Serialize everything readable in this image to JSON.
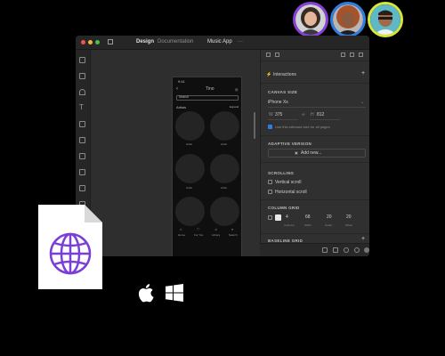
{
  "colors": {
    "background": "#000000",
    "accent_purple": "#7a3fd6",
    "avatar_ring_1": "#8b3fd9",
    "avatar_ring_2": "#2f7de0",
    "avatar_ring_3": "#d7e63a",
    "traffic_red": "#f0564b",
    "traffic_yellow": "#f1b83a",
    "traffic_green": "#4ac14a"
  },
  "avatars": [
    {
      "name": "avatar-woman-1"
    },
    {
      "name": "avatar-woman-2"
    },
    {
      "name": "avatar-man"
    }
  ],
  "window": {
    "titlebar": {
      "tab_design": "Design",
      "tab_documentation": "Documentation",
      "document_title": "Music App",
      "more": "···"
    },
    "phone": {
      "time": "9:41",
      "title": "Tino",
      "search_placeholder": "Search",
      "section_title": "Artists",
      "expand": "Expand",
      "artist_labels": [
        "Artist",
        "Artist",
        "Artist",
        "Artist"
      ],
      "tabs": [
        "Home",
        "For You",
        "Library",
        "Search"
      ]
    },
    "right_panel": {
      "interactions": "Interactions",
      "canvas_size_label": "CANVAS SIZE",
      "device": "iPhone Xs",
      "width_label": "W",
      "width": "375",
      "height_label": "H",
      "height": "812",
      "use_artboard": "Use this artboard size for all pages",
      "adaptive_label": "ADAPTIVE VERSION",
      "add_new": "Add new...",
      "scrolling_label": "SCROLLING",
      "vertical_scroll": "Vertical scroll",
      "horizontal_scroll": "Horizontal scroll",
      "column_grid_label": "COLUMN GRID",
      "grid_values": [
        {
          "value": "4",
          "label": "Columns"
        },
        {
          "value": "68",
          "label": "Width"
        },
        {
          "value": "20",
          "label": "Gutter"
        },
        {
          "value": "20",
          "label": "Offset"
        }
      ],
      "baseline_label": "BASELINE GRID"
    }
  },
  "platforms": [
    "apple-logo",
    "windows-logo"
  ]
}
